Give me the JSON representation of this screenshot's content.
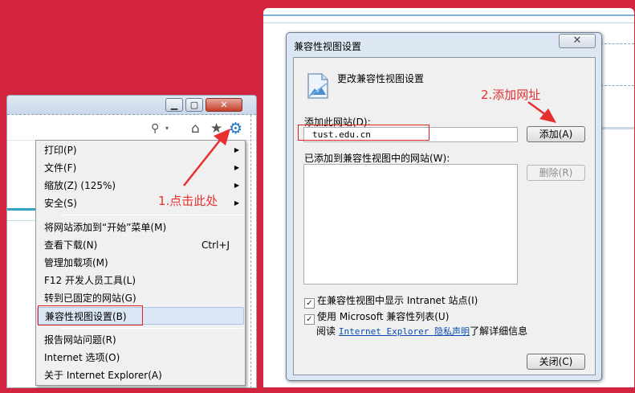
{
  "ie_window": {
    "title_buttons": {
      "minimize": "▁",
      "maximize": "▢",
      "close": "✕"
    },
    "icons": [
      "search-icon",
      "home-icon",
      "star-icon",
      "gear-icon"
    ],
    "search_glyph": "⚲",
    "dropdown_glyph": "▾",
    "home_glyph": "⌂",
    "star_glyph": "★",
    "gear_glyph": "⚙"
  },
  "tools_menu": {
    "items": [
      {
        "label": "打印(P)",
        "has_submenu": true
      },
      {
        "label": "文件(F)",
        "has_submenu": true
      },
      {
        "label": "缩放(Z) (125%)",
        "has_submenu": true
      },
      {
        "label": "安全(S)",
        "has_submenu": true
      },
      {
        "label": "将网站添加到“开始”菜单(M)"
      },
      {
        "label": "查看下载(N)",
        "shortcut": "Ctrl+J"
      },
      {
        "label": "管理加载项(M)"
      },
      {
        "label": "F12 开发人员工具(L)"
      },
      {
        "label": "转到已固定的网站(G)"
      },
      {
        "label": "兼容性视图设置(B)",
        "highlighted": true
      },
      {
        "label": "报告网站问题(R)"
      },
      {
        "label": "Internet 选项(O)"
      },
      {
        "label": "关于 Internet Explorer(A)"
      }
    ],
    "arrow_glyph": "▶"
  },
  "dialog": {
    "title": "兼容性视图设置",
    "close_glyph": "✕",
    "heading": "更改兼容性视图设置",
    "add_site_label": "添加此网站(D):",
    "add_site_value": "tust.edu.cn",
    "add_button": "添加(A)",
    "list_label": "已添加到兼容性视图中的网站(W):",
    "remove_button": "删除(R)",
    "checkbox_intranet": {
      "label": "在兼容性视图中显示 Intranet 站点(I)",
      "checked": true
    },
    "checkbox_mslist": {
      "label": "使用 Microsoft 兼容性列表(U)",
      "checked": true
    },
    "read_prefix": "阅读",
    "privacy_link": "Internet Explorer 隐私声明",
    "read_suffix": "了解详细信息",
    "close_button": "关闭(C)",
    "check_glyph": "✓"
  },
  "annotations": {
    "step1": "1.点击此处",
    "step2": "2.添加网址",
    "color": "#e63030"
  },
  "colors": {
    "background": "#d2233f",
    "gear": "#1a73c7",
    "link": "#0a4bb4"
  }
}
